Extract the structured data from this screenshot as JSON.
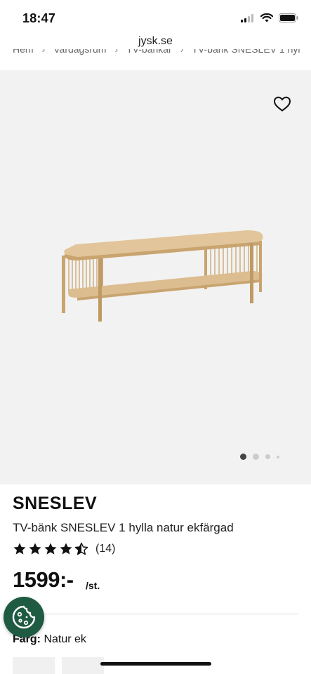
{
  "status": {
    "time": "18:47"
  },
  "browser": {
    "url": "jysk.se"
  },
  "breadcrumb": [
    "Hem",
    "Vardagsrum",
    "TV-bänkar",
    "TV-bänk SNESLEV 1 hyl"
  ],
  "gallery": {
    "image_count": 4,
    "active_index": 0
  },
  "product": {
    "name": "SNESLEV",
    "description": "TV-bänk SNESLEV 1 hylla natur ekfärgad",
    "rating": 4.5,
    "reviews": "(14)",
    "price": "1599:-",
    "price_unit": "/st."
  },
  "color": {
    "label": "Färg:",
    "value": "Natur ek"
  },
  "colors": {
    "cookie_bg": "#1f5a42",
    "gallery_bg": "#f2f2f2",
    "wood": "#d9b98a"
  }
}
